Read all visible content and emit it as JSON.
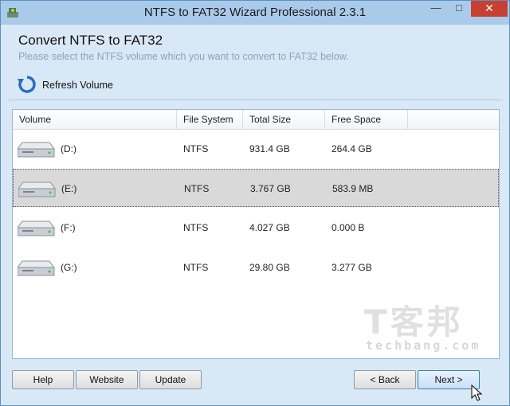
{
  "window": {
    "title": "NTFS to FAT32 Wizard Professional 2.3.1"
  },
  "header": {
    "title": "Convert NTFS to FAT32",
    "subtitle": "Please select the NTFS volume which you want to convert to FAT32 below."
  },
  "toolbar": {
    "refresh_label": "Refresh Volume"
  },
  "table": {
    "columns": [
      "Volume",
      "File System",
      "Total Size",
      "Free Space"
    ],
    "rows": [
      {
        "volume": "(D:)",
        "file_system": "NTFS",
        "total_size": "931.4 GB",
        "free_space": "264.4 GB",
        "selected": false
      },
      {
        "volume": "(E:)",
        "file_system": "NTFS",
        "total_size": "3.767 GB",
        "free_space": "583.9 MB",
        "selected": true
      },
      {
        "volume": "(F:)",
        "file_system": "NTFS",
        "total_size": "4.027 GB",
        "free_space": "0.000 B",
        "selected": false
      },
      {
        "volume": "(G:)",
        "file_system": "NTFS",
        "total_size": "29.80 GB",
        "free_space": "3.277 GB",
        "selected": false
      }
    ]
  },
  "watermark": {
    "line1": "T客邦",
    "line2": "techbang.com"
  },
  "buttons": {
    "help": "Help",
    "website": "Website",
    "update": "Update",
    "back": "< Back",
    "next": "Next >"
  },
  "colors": {
    "accent": "#3c7fb1",
    "close": "#c84031",
    "selected_row": "#d9d9d9"
  }
}
